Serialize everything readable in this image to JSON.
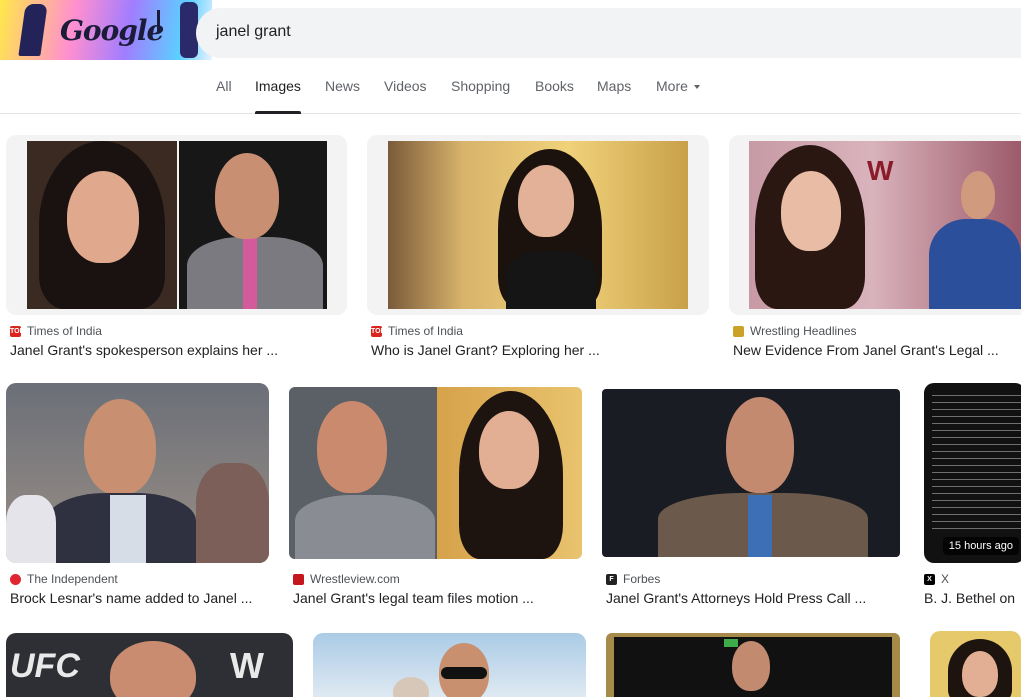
{
  "search": {
    "query": "janel grant"
  },
  "tabs": [
    {
      "label": "All"
    },
    {
      "label": "Images"
    },
    {
      "label": "News"
    },
    {
      "label": "Videos"
    },
    {
      "label": "Shopping"
    },
    {
      "label": "Books"
    },
    {
      "label": "Maps"
    },
    {
      "label": "More"
    }
  ],
  "results": [
    {
      "source": "Times of India",
      "title": "Janel Grant's spokesperson explains her ...",
      "favicon": "toi-icon",
      "favicon_color": "#d9251d"
    },
    {
      "source": "Times of India",
      "title": "Who is Janel Grant? Exploring her ...",
      "favicon": "toi-icon",
      "favicon_color": "#d9251d"
    },
    {
      "source": "Wrestling Headlines",
      "title": "New Evidence From Janel Grant's Legal ...",
      "favicon": "wh-icon",
      "favicon_color": "#c9a227"
    },
    {
      "source": "The Independent",
      "title": "Brock Lesnar's name added to Janel ...",
      "favicon": "independent-icon",
      "favicon_color": "#e0262f"
    },
    {
      "source": "Wrestleview.com",
      "title": "Janel Grant's legal team files motion ...",
      "favicon": "wrestleview-icon",
      "favicon_color": "#c4161c"
    },
    {
      "source": "Forbes",
      "title": "Janel Grant's Attorneys Hold Press Call ...",
      "favicon": "forbes-icon",
      "favicon_color": "#222222"
    },
    {
      "source": "X",
      "title": "B. J. Bethel on",
      "favicon": "x-icon",
      "favicon_color": "#000000",
      "badge": "15 hours ago"
    }
  ]
}
